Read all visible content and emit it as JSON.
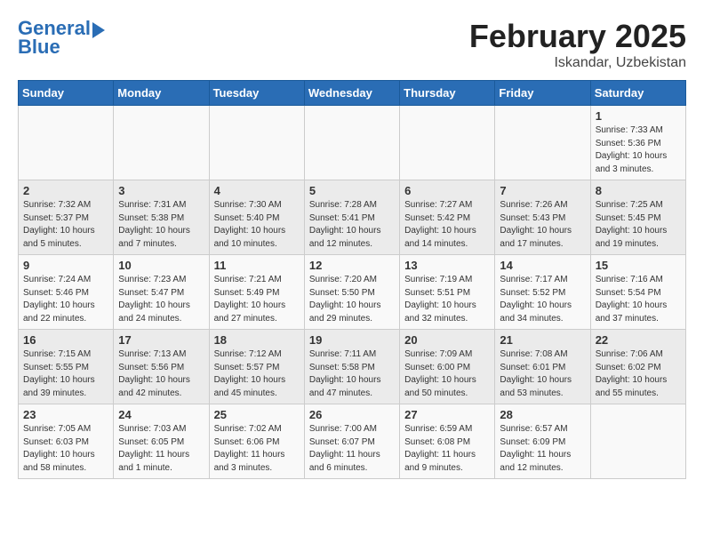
{
  "logo": {
    "line1": "General",
    "line2": "Blue"
  },
  "title": {
    "month": "February 2025",
    "location": "Iskandar, Uzbekistan"
  },
  "weekdays": [
    "Sunday",
    "Monday",
    "Tuesday",
    "Wednesday",
    "Thursday",
    "Friday",
    "Saturday"
  ],
  "weeks": [
    [
      {
        "day": "",
        "info": ""
      },
      {
        "day": "",
        "info": ""
      },
      {
        "day": "",
        "info": ""
      },
      {
        "day": "",
        "info": ""
      },
      {
        "day": "",
        "info": ""
      },
      {
        "day": "",
        "info": ""
      },
      {
        "day": "1",
        "info": "Sunrise: 7:33 AM\nSunset: 5:36 PM\nDaylight: 10 hours and 3 minutes."
      }
    ],
    [
      {
        "day": "2",
        "info": "Sunrise: 7:32 AM\nSunset: 5:37 PM\nDaylight: 10 hours and 5 minutes."
      },
      {
        "day": "3",
        "info": "Sunrise: 7:31 AM\nSunset: 5:38 PM\nDaylight: 10 hours and 7 minutes."
      },
      {
        "day": "4",
        "info": "Sunrise: 7:30 AM\nSunset: 5:40 PM\nDaylight: 10 hours and 10 minutes."
      },
      {
        "day": "5",
        "info": "Sunrise: 7:28 AM\nSunset: 5:41 PM\nDaylight: 10 hours and 12 minutes."
      },
      {
        "day": "6",
        "info": "Sunrise: 7:27 AM\nSunset: 5:42 PM\nDaylight: 10 hours and 14 minutes."
      },
      {
        "day": "7",
        "info": "Sunrise: 7:26 AM\nSunset: 5:43 PM\nDaylight: 10 hours and 17 minutes."
      },
      {
        "day": "8",
        "info": "Sunrise: 7:25 AM\nSunset: 5:45 PM\nDaylight: 10 hours and 19 minutes."
      }
    ],
    [
      {
        "day": "9",
        "info": "Sunrise: 7:24 AM\nSunset: 5:46 PM\nDaylight: 10 hours and 22 minutes."
      },
      {
        "day": "10",
        "info": "Sunrise: 7:23 AM\nSunset: 5:47 PM\nDaylight: 10 hours and 24 minutes."
      },
      {
        "day": "11",
        "info": "Sunrise: 7:21 AM\nSunset: 5:49 PM\nDaylight: 10 hours and 27 minutes."
      },
      {
        "day": "12",
        "info": "Sunrise: 7:20 AM\nSunset: 5:50 PM\nDaylight: 10 hours and 29 minutes."
      },
      {
        "day": "13",
        "info": "Sunrise: 7:19 AM\nSunset: 5:51 PM\nDaylight: 10 hours and 32 minutes."
      },
      {
        "day": "14",
        "info": "Sunrise: 7:17 AM\nSunset: 5:52 PM\nDaylight: 10 hours and 34 minutes."
      },
      {
        "day": "15",
        "info": "Sunrise: 7:16 AM\nSunset: 5:54 PM\nDaylight: 10 hours and 37 minutes."
      }
    ],
    [
      {
        "day": "16",
        "info": "Sunrise: 7:15 AM\nSunset: 5:55 PM\nDaylight: 10 hours and 39 minutes."
      },
      {
        "day": "17",
        "info": "Sunrise: 7:13 AM\nSunset: 5:56 PM\nDaylight: 10 hours and 42 minutes."
      },
      {
        "day": "18",
        "info": "Sunrise: 7:12 AM\nSunset: 5:57 PM\nDaylight: 10 hours and 45 minutes."
      },
      {
        "day": "19",
        "info": "Sunrise: 7:11 AM\nSunset: 5:58 PM\nDaylight: 10 hours and 47 minutes."
      },
      {
        "day": "20",
        "info": "Sunrise: 7:09 AM\nSunset: 6:00 PM\nDaylight: 10 hours and 50 minutes."
      },
      {
        "day": "21",
        "info": "Sunrise: 7:08 AM\nSunset: 6:01 PM\nDaylight: 10 hours and 53 minutes."
      },
      {
        "day": "22",
        "info": "Sunrise: 7:06 AM\nSunset: 6:02 PM\nDaylight: 10 hours and 55 minutes."
      }
    ],
    [
      {
        "day": "23",
        "info": "Sunrise: 7:05 AM\nSunset: 6:03 PM\nDaylight: 10 hours and 58 minutes."
      },
      {
        "day": "24",
        "info": "Sunrise: 7:03 AM\nSunset: 6:05 PM\nDaylight: 11 hours and 1 minute."
      },
      {
        "day": "25",
        "info": "Sunrise: 7:02 AM\nSunset: 6:06 PM\nDaylight: 11 hours and 3 minutes."
      },
      {
        "day": "26",
        "info": "Sunrise: 7:00 AM\nSunset: 6:07 PM\nDaylight: 11 hours and 6 minutes."
      },
      {
        "day": "27",
        "info": "Sunrise: 6:59 AM\nSunset: 6:08 PM\nDaylight: 11 hours and 9 minutes."
      },
      {
        "day": "28",
        "info": "Sunrise: 6:57 AM\nSunset: 6:09 PM\nDaylight: 11 hours and 12 minutes."
      },
      {
        "day": "",
        "info": ""
      }
    ]
  ]
}
